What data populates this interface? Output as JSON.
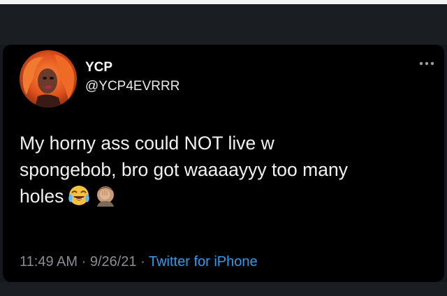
{
  "tweet": {
    "display_name": "YCP",
    "handle": "@YCP4EVRRR",
    "text_lines": [
      "My horny ass could NOT live w",
      "spongebob, bro got waaaayyy too many",
      "holes"
    ],
    "emojis": [
      "face-with-tears-of-joy",
      "face-palm"
    ],
    "time": "11:49 AM",
    "date": "9/26/21",
    "separator": "·",
    "source": "Twitter for iPhone"
  },
  "icons": {
    "more": "more-dots-icon",
    "avatar": "profile-avatar"
  },
  "colors": {
    "background": "#000000",
    "text": "#f2f2f2",
    "meta": "#8a8d91",
    "source_link": "#2d9cf0"
  }
}
